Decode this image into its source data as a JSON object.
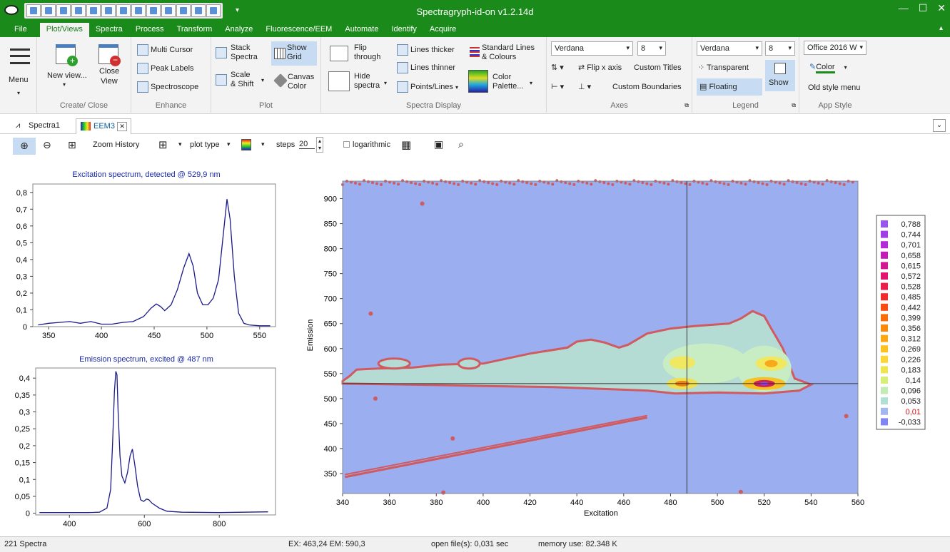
{
  "app": {
    "title": "Spectragryph-id-on    v1.2.14d"
  },
  "menu": [
    "File",
    "Plot/Views",
    "Spectra",
    "Process",
    "Transform",
    "Analyze",
    "Fluorescence/EEM",
    "Automate",
    "Identify",
    "Acquire"
  ],
  "ribbon": {
    "menu_label": "Menu",
    "new_view": "New view...",
    "close_view_1": "Close",
    "close_view_2": "View",
    "group_create": "Create/ Close",
    "multi_cursor": "Multi Cursor",
    "peak_labels": "Peak Labels",
    "spectroscope": "Spectroscope",
    "group_enhance": "Enhance",
    "stack_1": "Stack",
    "stack_2": "Spectra",
    "show_grid_1": "Show",
    "show_grid_2": "Grid",
    "scale_1": "Scale",
    "scale_2": "& Shift",
    "canvas_1": "Canvas",
    "canvas_2": "Color",
    "group_plot": "Plot",
    "flip_1": "Flip",
    "flip_2": "through",
    "hide_1": "Hide",
    "hide_2": "spectra",
    "lines_thicker": "Lines thicker",
    "lines_thinner": "Lines thinner",
    "points_lines": "Points/Lines",
    "std_lines_1": "Standard Lines",
    "std_lines_2": "& Colours",
    "palette_1": "Color",
    "palette_2": "Palette...",
    "group_display": "Spectra Display",
    "font_axes": "Verdana",
    "size_axes": "8",
    "flip_x": "Flip x axis",
    "custom_titles": "Custom Titles",
    "custom_boundaries": "Custom Boundaries",
    "group_axes": "Axes",
    "font_legend": "Verdana",
    "size_legend": "8",
    "transparent": "Transparent",
    "floating": "Floating",
    "show": "Show",
    "group_legend": "Legend",
    "style_select": "Office 2016 W",
    "color": "Color",
    "old_style": "Old style menu",
    "group_style": "App Style"
  },
  "tabs": [
    "Spectra1",
    "EEM3"
  ],
  "toolbar": {
    "zoom_history": "Zoom History",
    "plot_type": "plot type",
    "steps_label": "steps",
    "steps_value": "20",
    "logarithmic": "logarithmic"
  },
  "status": {
    "count": "221 Spectra",
    "cursor": "EX: 463,24 EM: 590,3",
    "open_time": "open file(s): 0,031 sec",
    "memory": "memory use: 82.348 K"
  },
  "chart_data": [
    {
      "type": "line",
      "title": "Excitation spectrum, detected @ 529,9 nm",
      "xlim": [
        335,
        565
      ],
      "ylim": [
        0,
        0.85
      ],
      "xticks": [
        350,
        400,
        450,
        500,
        550
      ],
      "yticks": [
        0,
        0.1,
        0.2,
        0.3,
        0.4,
        0.5,
        0.6,
        0.7,
        0.8
      ],
      "ytick_labels": [
        "0",
        "0,1",
        "0,2",
        "0,3",
        "0,4",
        "0,5",
        "0,6",
        "0,7",
        "0,8"
      ],
      "x": [
        340,
        350,
        360,
        370,
        380,
        390,
        400,
        410,
        420,
        430,
        440,
        447,
        452,
        456,
        460,
        466,
        472,
        478,
        483,
        487,
        491,
        496,
        501,
        506,
        511,
        516,
        519,
        522,
        526,
        530,
        535,
        540,
        550,
        560
      ],
      "y": [
        0.01,
        0.02,
        0.025,
        0.03,
        0.02,
        0.03,
        0.015,
        0.015,
        0.025,
        0.03,
        0.06,
        0.11,
        0.135,
        0.12,
        0.095,
        0.13,
        0.22,
        0.35,
        0.435,
        0.36,
        0.2,
        0.13,
        0.13,
        0.17,
        0.28,
        0.58,
        0.76,
        0.64,
        0.3,
        0.08,
        0.02,
        0.01,
        0.005,
        0.005
      ]
    },
    {
      "type": "line",
      "title": "Emission spectrum, excited @ 487 nm",
      "xlim": [
        310,
        950
      ],
      "ylim": [
        -0.005,
        0.43
      ],
      "xticks": [
        400,
        600,
        800
      ],
      "yticks": [
        0,
        0.05,
        0.1,
        0.15,
        0.2,
        0.25,
        0.3,
        0.35,
        0.4
      ],
      "ytick_labels": [
        "0",
        "0,05",
        "0,1",
        "0,15",
        "0,2",
        "0,25",
        "0,3",
        "0,35",
        "0,4"
      ],
      "x": [
        320,
        400,
        450,
        480,
        500,
        510,
        515,
        520,
        524,
        527,
        530,
        535,
        540,
        548,
        555,
        562,
        568,
        575,
        582,
        590,
        598,
        606,
        612,
        620,
        640,
        660,
        700,
        800,
        930
      ],
      "y": [
        0.002,
        0.002,
        0.002,
        0.003,
        0.015,
        0.07,
        0.2,
        0.36,
        0.42,
        0.41,
        0.3,
        0.17,
        0.11,
        0.09,
        0.12,
        0.17,
        0.19,
        0.14,
        0.08,
        0.04,
        0.035,
        0.042,
        0.04,
        0.03,
        0.015,
        0.006,
        0.003,
        0.002,
        0.004
      ]
    },
    {
      "type": "heatmap",
      "xlabel": "Excitation",
      "ylabel": "Emission",
      "xlim": [
        340,
        560
      ],
      "ylim": [
        310,
        935
      ],
      "xticks": [
        340,
        360,
        380,
        400,
        420,
        440,
        460,
        480,
        500,
        520,
        540,
        560
      ],
      "yticks": [
        350,
        400,
        450,
        500,
        550,
        600,
        650,
        700,
        750,
        800,
        850,
        900
      ],
      "cursor": {
        "x": 487,
        "y": 529.9
      },
      "legend": [
        "0,788",
        "0,744",
        "0,701",
        "0,658",
        "0,615",
        "0,572",
        "0,528",
        "0,485",
        "0,442",
        "0,399",
        "0,356",
        "0,312",
        "0,269",
        "0,226",
        "0,183",
        "0,14",
        "0,096",
        "0,053",
        "0,01",
        "-0,033"
      ],
      "legend_colors": [
        "#9a55f0",
        "#a23ee6",
        "#b42ad6",
        "#c41cb8",
        "#d41694",
        "#e4146e",
        "#ee1e4a",
        "#f42a2a",
        "#f84c12",
        "#fa6c06",
        "#fc8a08",
        "#fda812",
        "#fec21e",
        "#fcd632",
        "#eee64c",
        "#d8ee78",
        "#c2ecb4",
        "#b0e0d4",
        "#a2b6f0",
        "#7f86f4"
      ],
      "highlighted_legend": "0,01"
    }
  ]
}
